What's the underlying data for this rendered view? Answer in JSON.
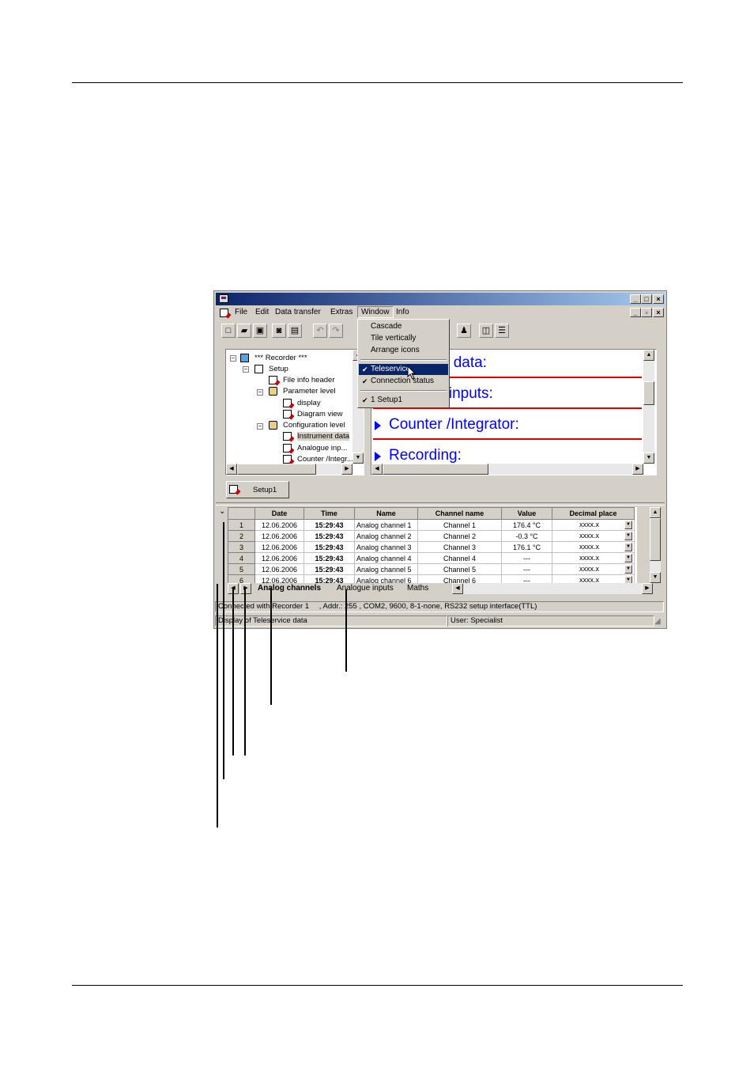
{
  "menubar": {
    "items": [
      "File",
      "Edit",
      "Data transfer",
      "Extras",
      "Window",
      "Info"
    ]
  },
  "window_menu": {
    "items": [
      "Cascade",
      "Tile vertically",
      "Arrange icons"
    ],
    "teleservice": "Teleservice",
    "connection_status": "Connection status",
    "recent": "1 Setup1"
  },
  "tree": {
    "nodes": [
      "*** Recorder ***",
      "Setup",
      "File info header",
      "Parameter level",
      "display",
      "Diagram view",
      "Configuration level",
      "Instrument data",
      "Analogue inp...",
      "Counter /Integr..."
    ]
  },
  "content": {
    "sections": [
      "ent data:",
      "e inputs:",
      "Counter /Integrator:",
      "Recording:"
    ]
  },
  "document_tab": "Setup1",
  "grid": {
    "columns": [
      "Date",
      "Time",
      "Name",
      "Channel name",
      "Value",
      "Decimal place"
    ],
    "rows": [
      {
        "n": "1",
        "date": "12.06.2006",
        "time": "15:29:43",
        "name": "Analog channel 1",
        "channel": "Channel 1",
        "value": "176.4 °C",
        "decimal": "xxxx.x"
      },
      {
        "n": "2",
        "date": "12.06.2006",
        "time": "15:29:43",
        "name": "Analog channel 2",
        "channel": "Channel 2",
        "value": "-0.3 °C",
        "decimal": "xxxx.x"
      },
      {
        "n": "3",
        "date": "12.06.2006",
        "time": "15:29:43",
        "name": "Analog channel 3",
        "channel": "Channel 3",
        "value": "176.1 °C",
        "decimal": "xxxx.x"
      },
      {
        "n": "4",
        "date": "12.06.2006",
        "time": "15:29:43",
        "name": "Analog channel 4",
        "channel": "Channel 4",
        "value": "---",
        "decimal": "xxxx.x"
      },
      {
        "n": "5",
        "date": "12.06.2006",
        "time": "15:29:43",
        "name": "Analog channel 5",
        "channel": "Channel 5",
        "value": "---",
        "decimal": "xxxx.x"
      },
      {
        "n": "6",
        "date": "12.06.2006",
        "time": "15:29:43",
        "name": "Analog channel 6",
        "channel": "Channel 6",
        "value": "---",
        "decimal": "xxxx.x"
      }
    ]
  },
  "sheet_tabs": [
    "Analog channels",
    "Analogue inputs",
    "Maths"
  ],
  "status": {
    "connection": "Connected with Recorder 1",
    "address": ", Addr.: 255 , COM2, 9600, 8-1-none, RS232 setup interface(TTL)",
    "display": "Display of Teleservice data",
    "user": "User: Specialist"
  }
}
